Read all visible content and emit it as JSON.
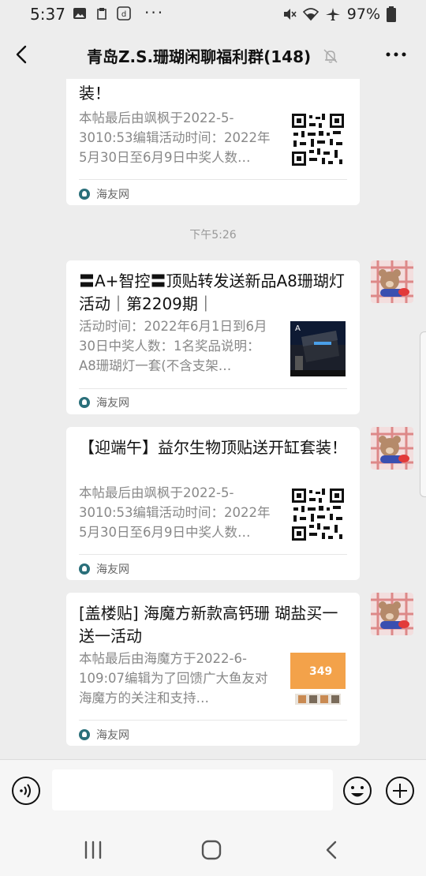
{
  "status_bar": {
    "time": "5:37",
    "battery": "97%",
    "icons": [
      "image-icon",
      "clipboard-icon",
      "tiktok-icon",
      "more-dots-icon",
      "mute-icon",
      "wifi-icon",
      "airplane-icon",
      "battery-icon"
    ]
  },
  "header": {
    "title": "青岛Z.S.珊瑚闲聊福利群(148)",
    "icons": [
      "back-icon",
      "mute-bell-icon",
      "more-icon"
    ]
  },
  "messages": [
    {
      "title": "装！",
      "desc": "本帖最后由飒枫于2022-5-3010:53编辑活动时间：2022年5月30日至6月9日中奖人数…",
      "thumb": "qr-code",
      "source": "海友网"
    },
    {
      "timestamp": "下午5:26"
    },
    {
      "title": "〓A+智控〓顶贴转发送新品A8珊瑚灯活动｜第2209期｜",
      "desc": "活动时间：2022年6月1日到6月30日中奖人数：1名奖品说明：A8珊瑚灯一套(不含支架…",
      "thumb": "lamp-photo",
      "source": "海友网"
    },
    {
      "title": "【迎端午】益尔生物顶贴送开缸套装！",
      "desc": "本帖最后由飒枫于2022-5-3010:53编辑活动时间：2022年5月30日至6月9日中奖人数…",
      "thumb": "qr-code",
      "source": "海友网"
    },
    {
      "title": "[盖楼贴] 海魔方新款高钙珊 瑚盐买一送一活动",
      "desc": "本帖最后由海魔方于2022-6-109:07编辑为了回馈广大鱼友对海魔方的关注和支持…",
      "thumb": "salt-product-photo",
      "thumb_text": "349",
      "source": "海友网"
    }
  ],
  "input_bar": {
    "icons": [
      "voice-icon",
      "emoji-icon",
      "plus-icon"
    ],
    "placeholder": ""
  },
  "nav_bar": {
    "icons": [
      "recent-apps-icon",
      "home-icon",
      "back-nav-icon"
    ]
  },
  "colors": {
    "background": "#ededed",
    "card": "#ffffff",
    "desc_text": "#888888",
    "source_logo": "#2a6f7a"
  }
}
